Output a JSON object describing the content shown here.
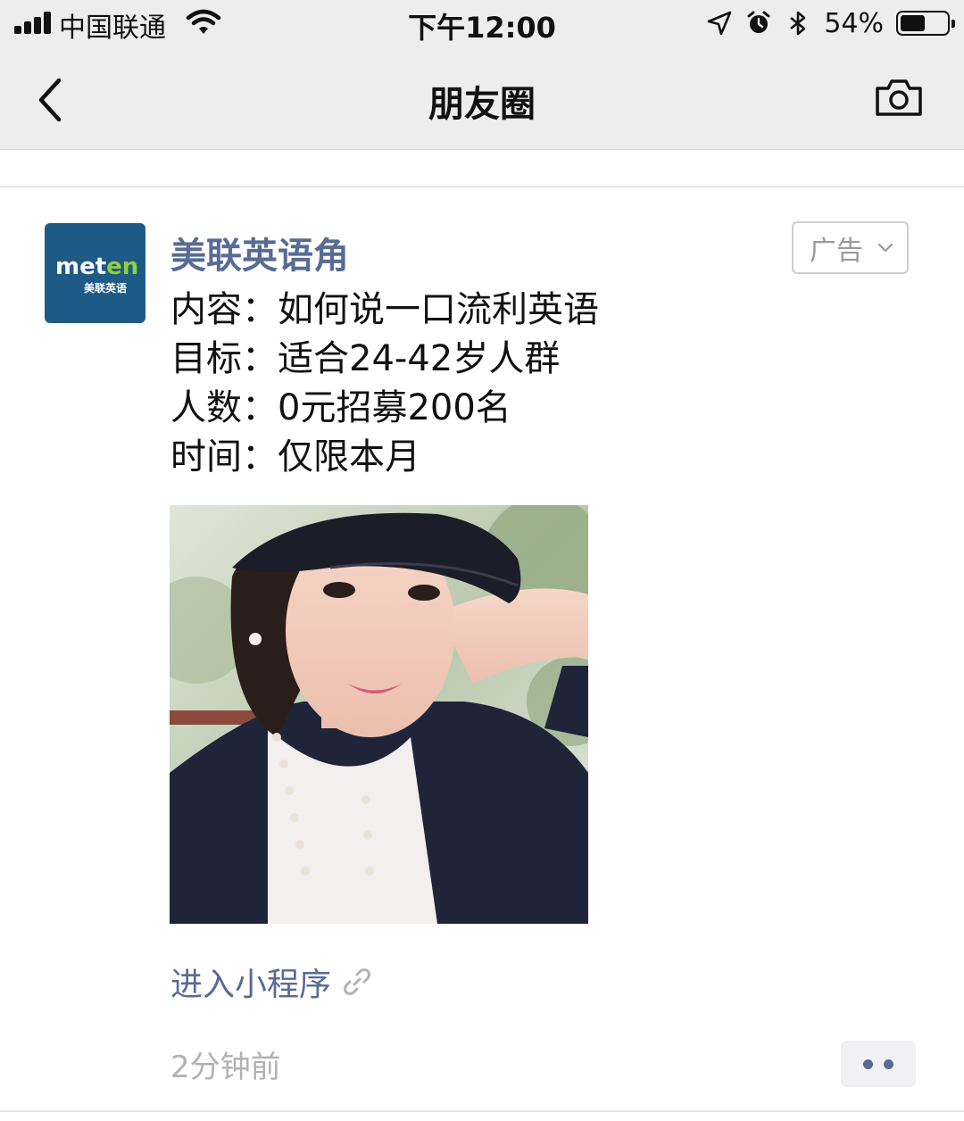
{
  "status_bar": {
    "carrier": "中国联通",
    "time": "下午12:00",
    "battery_percent": "54%",
    "battery_level": 0.54,
    "icons": [
      "signal-icon",
      "wifi-icon",
      "location-icon",
      "alarm-icon",
      "bluetooth-icon",
      "battery-icon"
    ]
  },
  "nav": {
    "title": "朋友圈",
    "back_icon": "chevron-left-icon",
    "camera_icon": "camera-icon"
  },
  "post": {
    "author": "美联英语角",
    "avatar_logo_en_a": "met",
    "avatar_logo_en_b": "en",
    "avatar_logo_cn": "美联英语",
    "ad_label": "广告",
    "lines": [
      "内容：如何说一口流利英语",
      "目标：适合24-42岁人群",
      "人数：0元招募200名",
      "时间：仅限本月"
    ],
    "mini_program_label": "进入小程序",
    "time_ago": "2分钟前"
  },
  "colors": {
    "link_blue": "#576b95",
    "nav_bg": "#ededed",
    "avatar_bg": "#1e5a86"
  }
}
